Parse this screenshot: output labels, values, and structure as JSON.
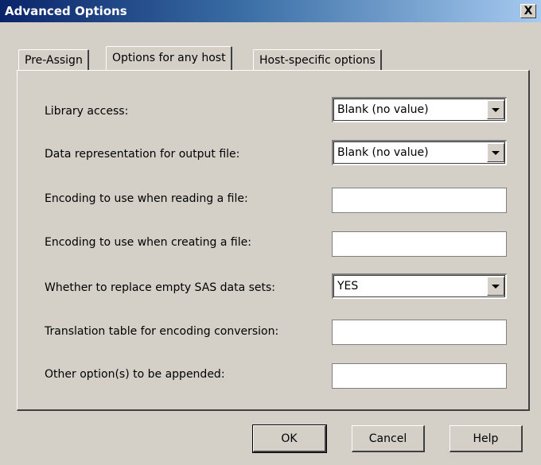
{
  "window": {
    "title": "Advanced Options",
    "close_glyph": "X"
  },
  "tabs": [
    {
      "label": "Pre-Assign",
      "active": false
    },
    {
      "label": "Options for any host",
      "active": true
    },
    {
      "label": "Host-specific options",
      "active": false
    }
  ],
  "options": [
    {
      "label": "Library access:",
      "control": "combo",
      "value": "Blank (no value)"
    },
    {
      "label": "Data representation for output file:",
      "control": "combo",
      "value": "Blank (no value)"
    },
    {
      "label": "Encoding to use when reading a file:",
      "control": "text",
      "value": ""
    },
    {
      "label": "Encoding to use when creating a file:",
      "control": "text",
      "value": ""
    },
    {
      "label": "Whether to replace empty SAS data sets:",
      "control": "combo",
      "value": "YES"
    },
    {
      "label": "Translation table for encoding conversion:",
      "control": "text",
      "value": ""
    },
    {
      "label": "Other option(s) to be appended:",
      "control": "text",
      "value": ""
    }
  ],
  "buttons": {
    "ok": "OK",
    "cancel": "Cancel",
    "help": "Help"
  },
  "icons": {
    "close": "close-icon",
    "dropdown": "chevron-down-icon"
  },
  "colors": {
    "dialog_bg": "#d4d0c8",
    "title_start": "#0a246a",
    "title_end": "#a6caf0"
  }
}
